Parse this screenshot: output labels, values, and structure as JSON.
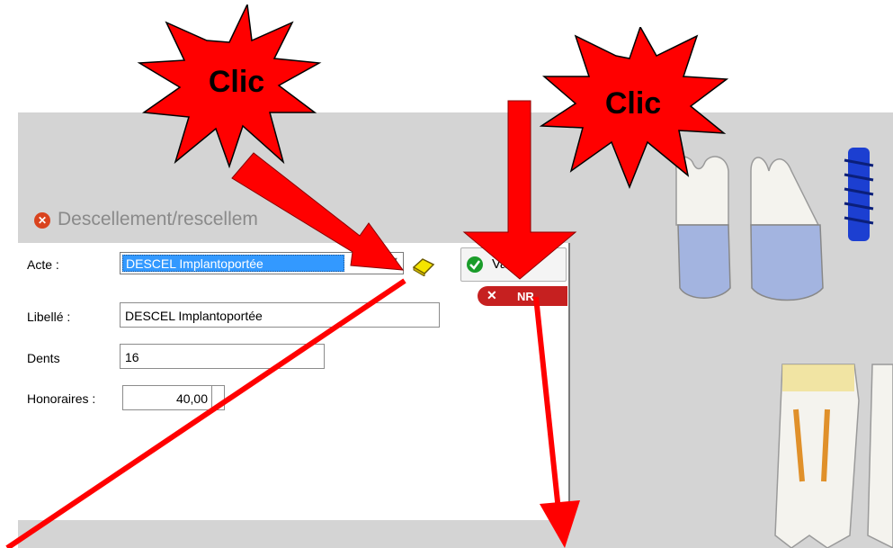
{
  "annotations": {
    "clic_left": "Clic",
    "clic_right": "Clic"
  },
  "dialog": {
    "title": "Descellement/rescellem",
    "acte_label": "Acte :",
    "acte_value": "DESCEL Implantoportée",
    "libelle_label": "Libellé :",
    "libelle_value": "DESCEL Implantoportée",
    "dents_label": "Dents",
    "dents_value": "16",
    "honoraires_label": "Honoraires :",
    "honoraires_value": "40,00",
    "valider_label": "Va",
    "nr_label": "NR"
  },
  "colors": {
    "annotation_red": "#ff0000",
    "selection_blue": "#3399ff",
    "close_red": "#d9431e",
    "valider_green": "#1a9c2a",
    "nr_red": "#c62020"
  },
  "icons": [
    "close-circle-icon",
    "book-icon",
    "check-circle-icon",
    "x-icon",
    "tooth-illustration",
    "implant-screw-illustration"
  ]
}
